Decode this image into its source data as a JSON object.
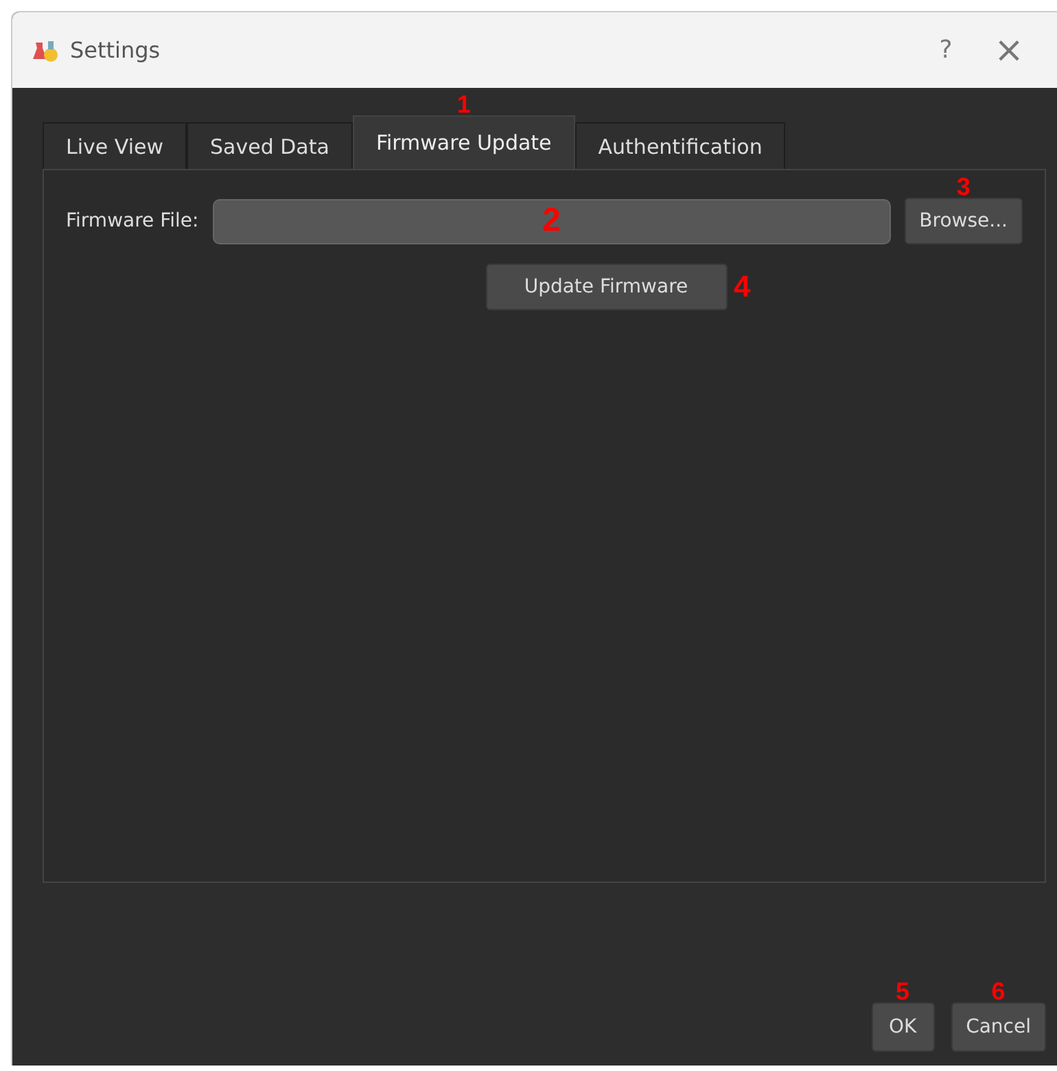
{
  "window": {
    "title": "Settings",
    "help": "?",
    "close": "×"
  },
  "tabs": [
    {
      "label": "Live View",
      "selected": false
    },
    {
      "label": "Saved Data",
      "selected": false
    },
    {
      "label": "Firmware Update",
      "selected": true,
      "marker": "1"
    },
    {
      "label": "Authentification",
      "selected": false
    }
  ],
  "firmware_file": {
    "label": "Firmware File:",
    "marker": "2"
  },
  "browse_button": {
    "label": "Browse...",
    "marker": "3"
  },
  "update_button": {
    "label": "Update Firmware",
    "marker": "4"
  },
  "buttons": [
    {
      "label": "OK",
      "marker": "5"
    },
    {
      "label": "Cancel",
      "marker": "6"
    }
  ]
}
